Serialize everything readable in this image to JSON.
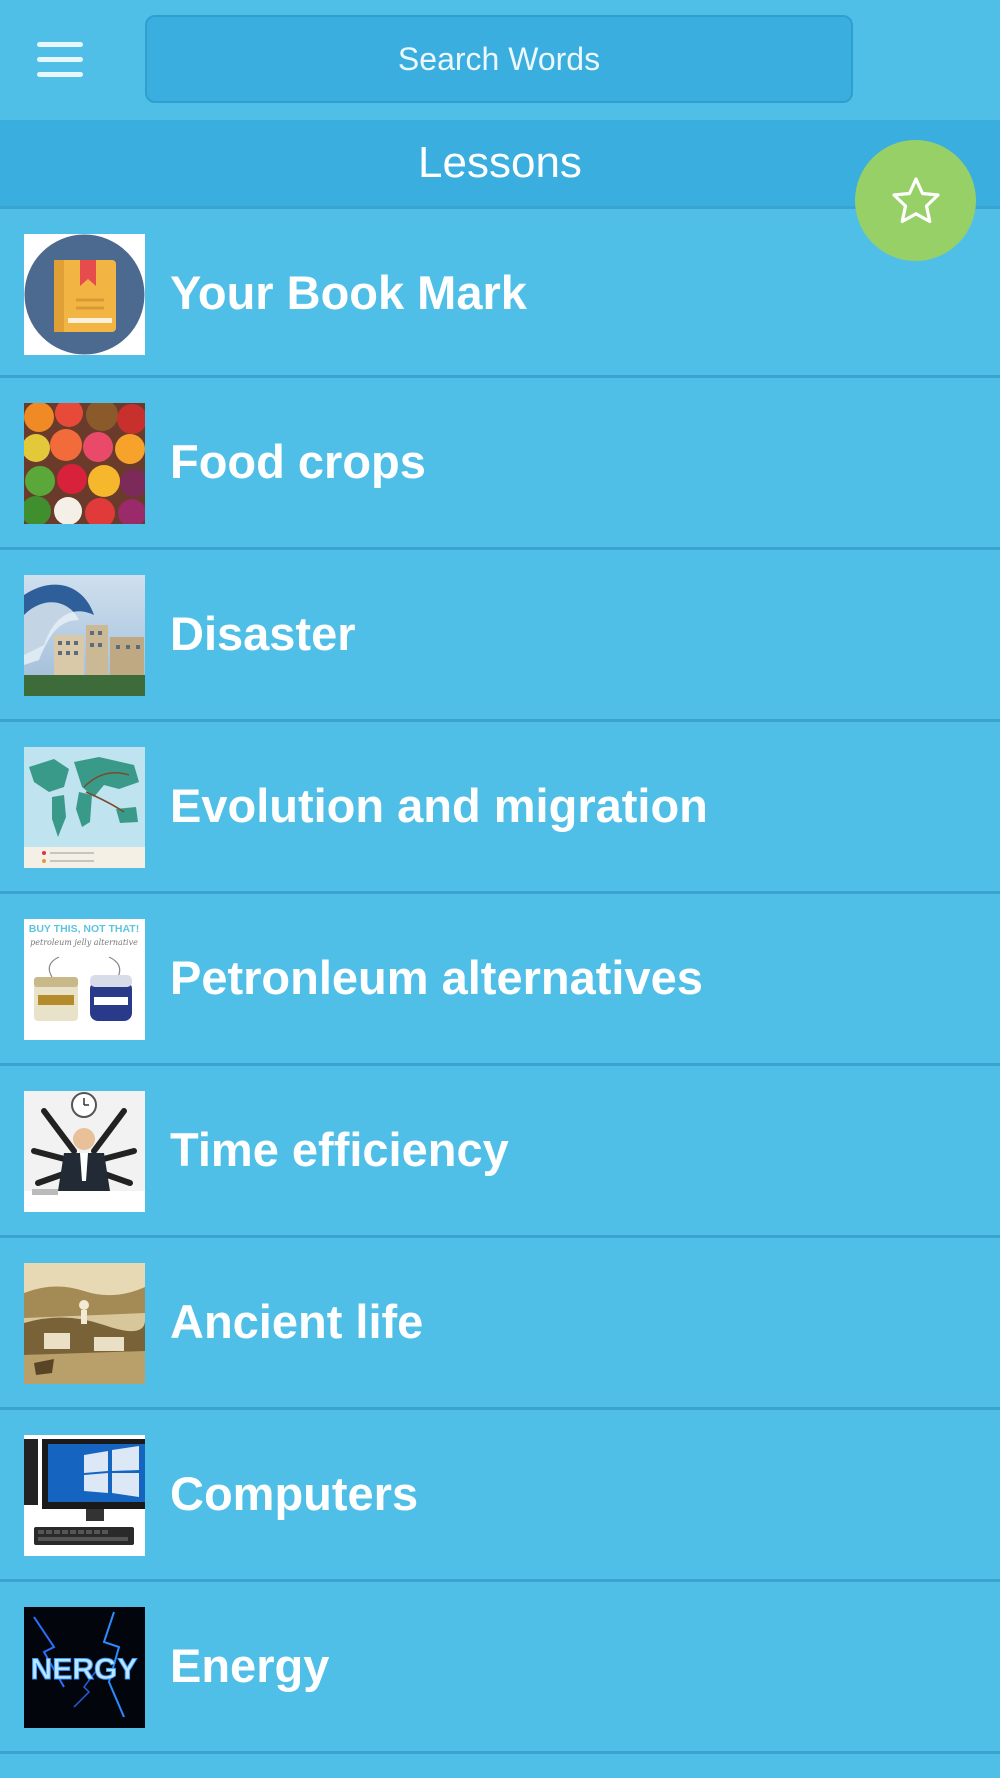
{
  "search": {
    "placeholder": "Search Words"
  },
  "header": {
    "title": "Lessons"
  },
  "icons": {
    "menu": "hamburger-menu-icon",
    "fab": "star-icon"
  },
  "colors": {
    "background": "#4fbfe7",
    "header": "#3aaede",
    "fab": "#97d067",
    "text": "#ffffff"
  },
  "lessons": [
    {
      "label": "Your Book Mark",
      "thumb": "bookmark-book-icon"
    },
    {
      "label": "Food crops",
      "thumb": "fruits-vegetables-image"
    },
    {
      "label": "Disaster",
      "thumb": "tsunami-wave-image"
    },
    {
      "label": "Evolution and migration",
      "thumb": "world-migration-map-image"
    },
    {
      "label": "Petronleum alternatives",
      "thumb": "petroleum-jelly-jars-image",
      "thumb_text": [
        "BUY THIS, NOT THAT!",
        "petroleum jelly alternative"
      ]
    },
    {
      "label": "Time efficiency",
      "thumb": "multitasking-businessman-image"
    },
    {
      "label": "Ancient life",
      "thumb": "ancient-scene-painting-image"
    },
    {
      "label": "Computers",
      "thumb": "desktop-computer-image"
    },
    {
      "label": "Energy",
      "thumb": "energy-lightning-text-image",
      "thumb_text": [
        "NERGY"
      ]
    }
  ]
}
